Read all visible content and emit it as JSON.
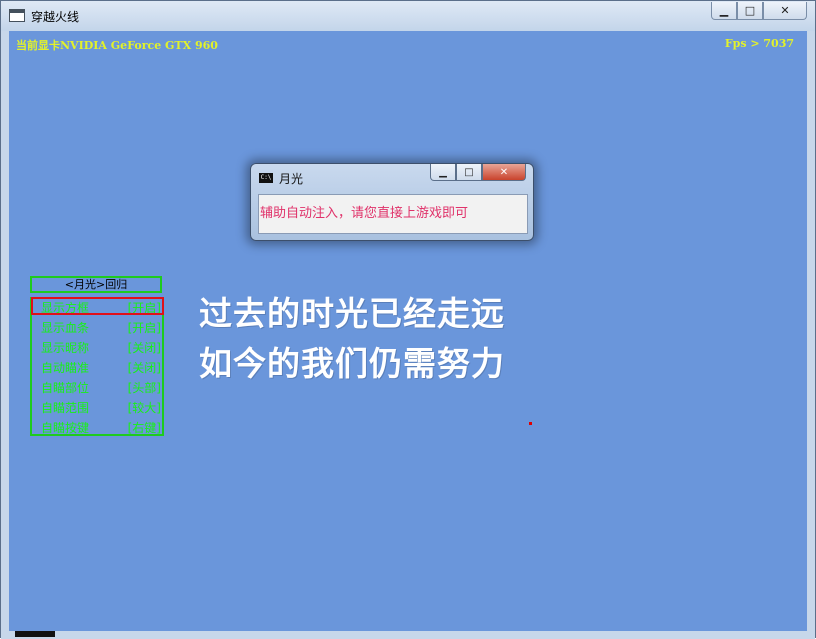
{
  "window": {
    "title": "穿越火线",
    "min_icon": "minimize-icon",
    "max_icon": "maximize-icon",
    "close_icon": "close-icon"
  },
  "hud": {
    "gpu_label": "当前显卡NVIDIA GeForce GTX 960",
    "fps_label": "Fps > 7037"
  },
  "menu": {
    "header": "<月光>回归",
    "items": [
      {
        "label": "显示方框",
        "state": "[开启]"
      },
      {
        "label": "显示血条",
        "state": "[开启]"
      },
      {
        "label": "显示昵称",
        "state": "[关闭]"
      },
      {
        "label": "自动瞄准",
        "state": "[关闭]"
      },
      {
        "label": "自瞄部位",
        "state": "[头部]"
      },
      {
        "label": "自瞄范围",
        "state": "[较大]"
      },
      {
        "label": "自瞄按键",
        "state": "[右键]"
      }
    ],
    "selected_index": 0
  },
  "slogan": {
    "line1": "过去的时光已经走远",
    "line2": "如今的我们仍需努力"
  },
  "dialog": {
    "title": "月光",
    "icon_text": "C:\\",
    "message": "辅助自动注入，请您直接上游戏即可"
  },
  "colors": {
    "game_bg": "#6a96db",
    "hud_text": "#e2f22a",
    "menu_green": "#1ecb1e",
    "selection_red": "#e0101a",
    "message_pink": "#e0326a"
  }
}
